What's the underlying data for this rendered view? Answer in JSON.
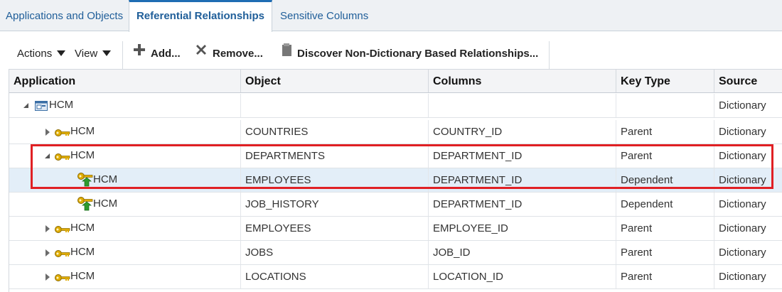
{
  "tabs": [
    {
      "label": "Applications and Objects"
    },
    {
      "label": "Referential Relationships"
    },
    {
      "label": "Sensitive Columns"
    }
  ],
  "toolbar": {
    "actions_label": "Actions",
    "view_label": "View",
    "add_label": "Add...",
    "remove_label": "Remove...",
    "discover_label": "Discover Non-Dictionary Based Relationships..."
  },
  "table": {
    "columns": [
      "Application",
      "Object",
      "Columns",
      "Key Type",
      "Source"
    ],
    "rows": [
      {
        "application": "HCM",
        "object": "",
        "columns": "",
        "key_type": "",
        "source": "Dictionary",
        "icon": "application-icon",
        "tree": "expanded"
      },
      {
        "application": "HCM",
        "object": "COUNTRIES",
        "columns": "COUNTRY_ID",
        "key_type": "Parent",
        "source": "Dictionary",
        "icon": "key-icon",
        "tree": "collapsed"
      },
      {
        "application": "HCM",
        "object": "DEPARTMENTS",
        "columns": "DEPARTMENT_ID",
        "key_type": "Parent",
        "source": "Dictionary",
        "icon": "key-icon",
        "tree": "expanded"
      },
      {
        "application": "HCM",
        "object": "EMPLOYEES",
        "columns": "DEPARTMENT_ID",
        "key_type": "Dependent",
        "source": "Dictionary",
        "icon": "dependent-key-icon",
        "tree": "none",
        "selected": true
      },
      {
        "application": "HCM",
        "object": "JOB_HISTORY",
        "columns": "DEPARTMENT_ID",
        "key_type": "Dependent",
        "source": "Dictionary",
        "icon": "dependent-key-icon",
        "tree": "none"
      },
      {
        "application": "HCM",
        "object": "EMPLOYEES",
        "columns": "EMPLOYEE_ID",
        "key_type": "Parent",
        "source": "Dictionary",
        "icon": "key-icon",
        "tree": "collapsed"
      },
      {
        "application": "HCM",
        "object": "JOBS",
        "columns": "JOB_ID",
        "key_type": "Parent",
        "source": "Dictionary",
        "icon": "key-icon",
        "tree": "collapsed"
      },
      {
        "application": "HCM",
        "object": "LOCATIONS",
        "columns": "LOCATION_ID",
        "key_type": "Parent",
        "source": "Dictionary",
        "icon": "key-icon",
        "tree": "collapsed"
      }
    ]
  },
  "colors": {
    "tab_active_border": "#1f6db3",
    "link_blue": "#1f5e99",
    "highlight_red": "#e02024",
    "selected_row": "#e3eef8",
    "key_gold": "#d9a400",
    "dependent_green": "#2e9a2e"
  }
}
